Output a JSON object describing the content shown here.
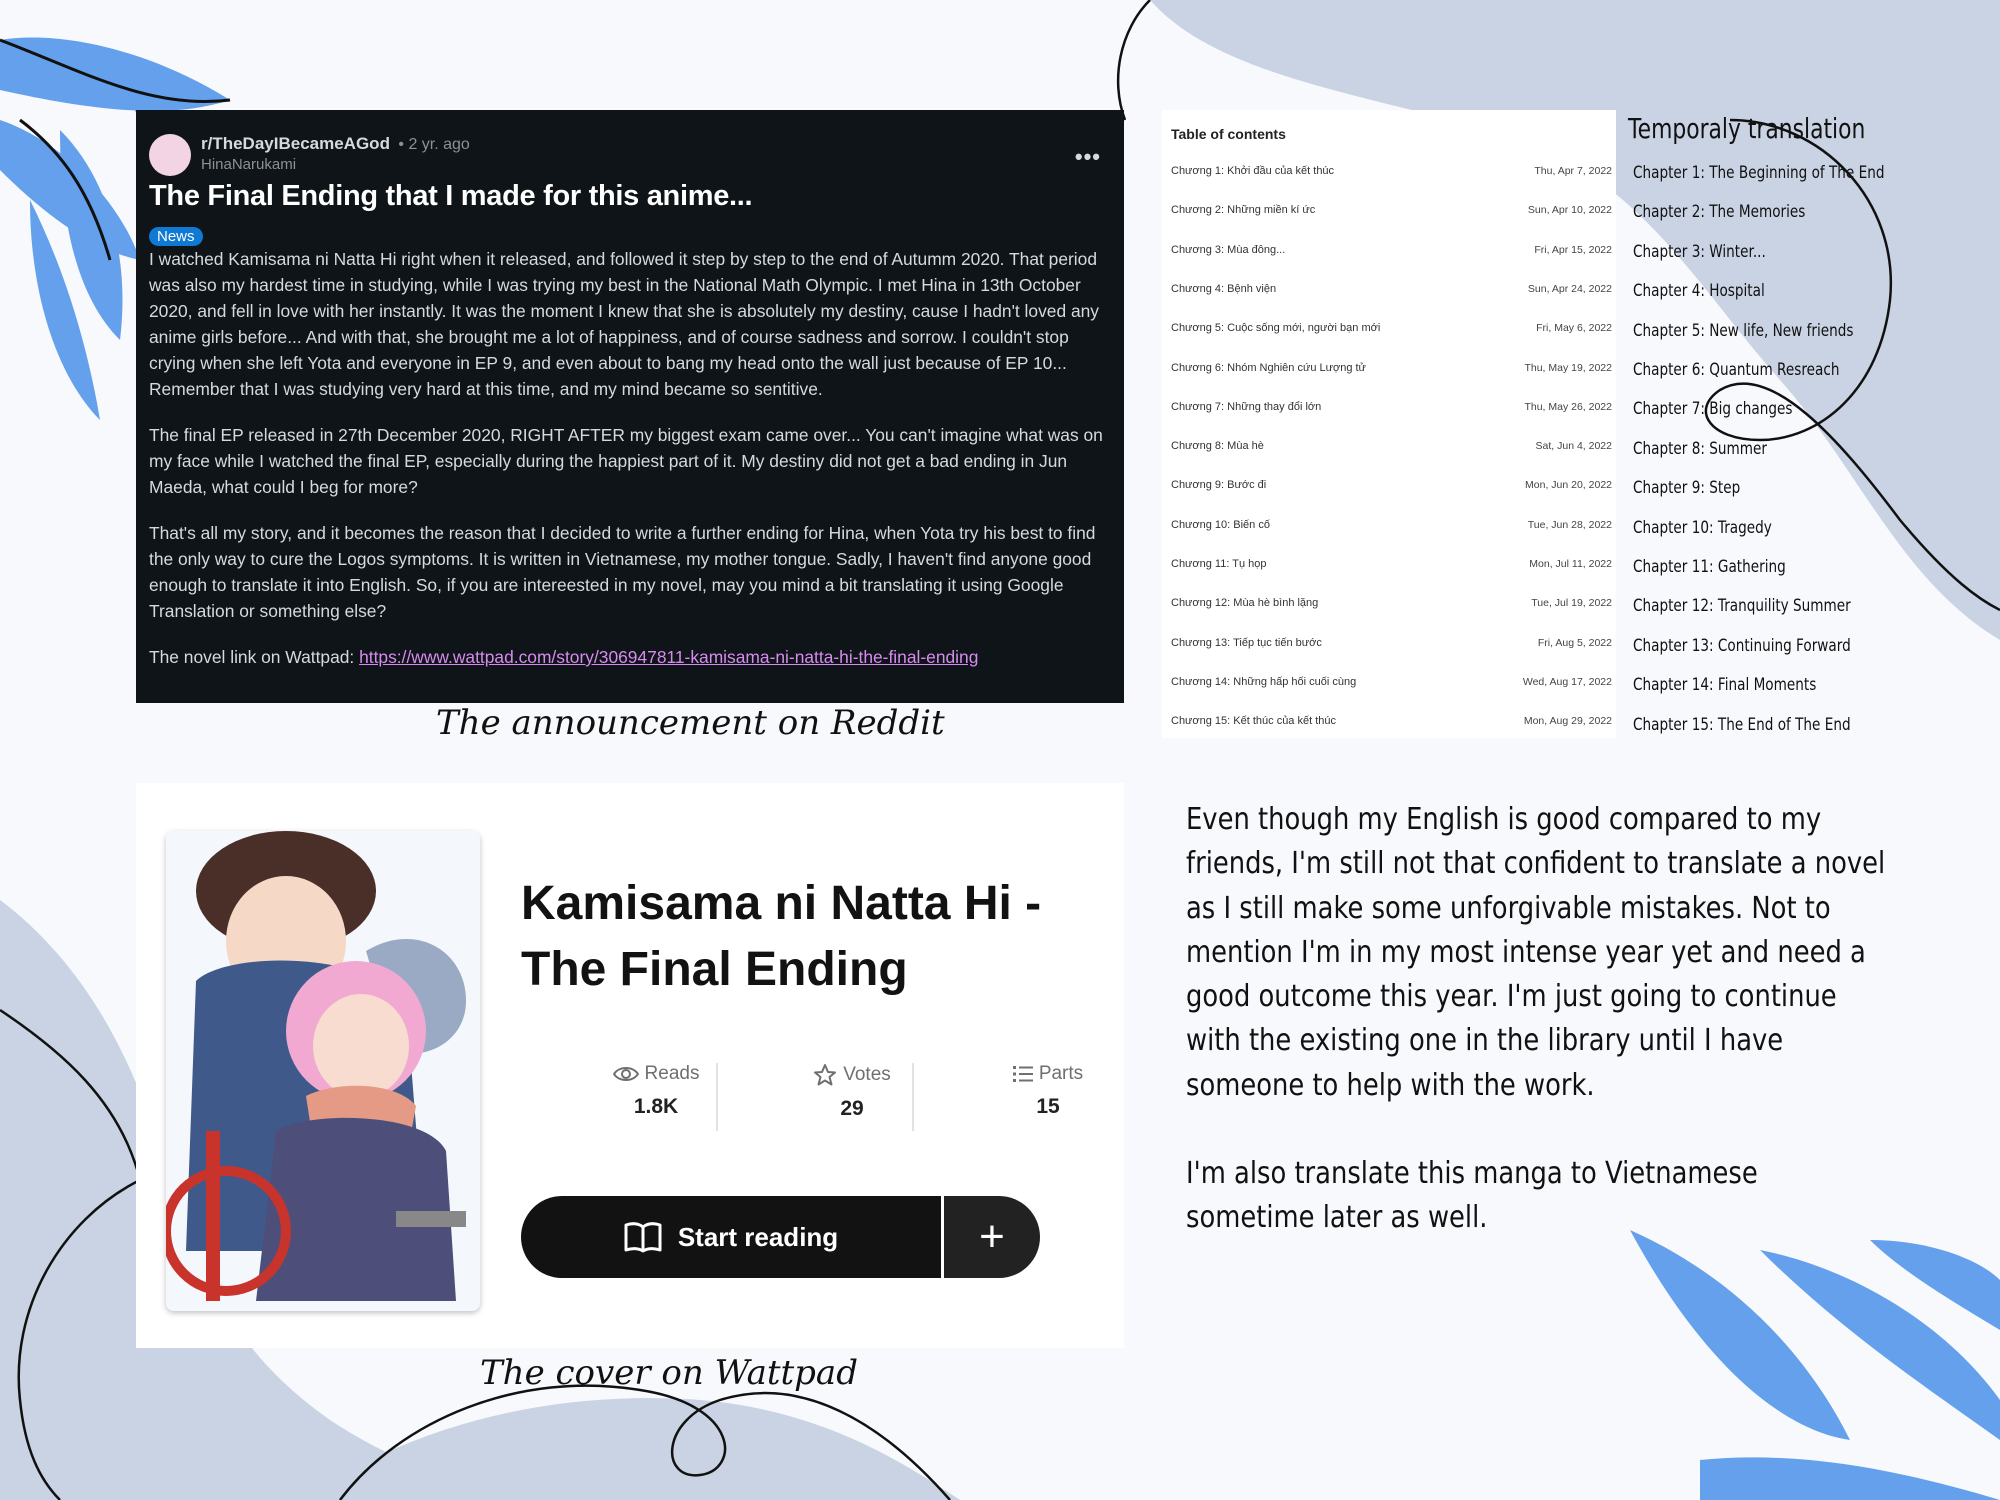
{
  "reddit": {
    "subreddit": "r/TheDayIBecameAGod",
    "time": "• 2 yr. ago",
    "user": "HinaNarukami",
    "more": "•••",
    "title": "The Final Ending that I made for this anime...",
    "badge": "News",
    "p1": "I watched Kamisama ni Natta Hi right when it released, and followed it step by step to the end of Autumm 2020. That period was also my hardest time in studying, while I was trying my best in the National Math Olympic. I met Hina in 13th October 2020, and fell in love with her instantly. It was the moment I knew that she is absolutely my destiny, cause I hadn't loved any anime girls before... And with that, she brought me a lot of happiness, and of course sadness and sorrow. I couldn't stop crying when she left Yota and everyone in EP 9, and even about to bang my head onto the wall just because of EP 10... Remember that I was studying very hard at this time, and my mind became so sentitive.",
    "p2": "The final EP released in 27th December 2020, RIGHT AFTER my biggest exam came over... You can't imagine what was on my face while I watched the final EP, especially during the happiest part of it. My destiny did not get a bad ending in Jun Maeda, what could I beg for more?",
    "p3": "That's all my story, and it becomes the reason that I decided to write a further ending for Hina, when Yota try his best to find the only way to cure the Logos symptoms. It is written in Vietnamese, my mother tongue. Sadly, I haven't find anyone good enough to translate it into English. So, if you are intereested in my novel, may you mind a bit translating it using Google Translation or something else?",
    "link_prefix": "The novel link on Wattpad: ",
    "link": "https://www.wattpad.com/story/306947811-kamisama-ni-natta-hi-the-final-ending"
  },
  "captions": {
    "reddit": "The announcement on Reddit",
    "wattpad": "The cover on Wattpad"
  },
  "toc": {
    "title": "Table of contents",
    "rows": [
      {
        "name": "Chương 1: Khởi đầu của kết thúc",
        "date": "Thu, Apr 7, 2022"
      },
      {
        "name": "Chương 2: Những miền kí ức",
        "date": "Sun, Apr 10, 2022"
      },
      {
        "name": "Chương 3: Mùa đông...",
        "date": "Fri, Apr 15, 2022"
      },
      {
        "name": "Chương 4: Bệnh viện",
        "date": "Sun, Apr 24, 2022"
      },
      {
        "name": "Chương 5: Cuộc sống mới, người bạn mới",
        "date": "Fri, May 6, 2022"
      },
      {
        "name": "Chương 6: Nhóm Nghiên cứu Lượng tử",
        "date": "Thu, May 19, 2022"
      },
      {
        "name": "Chương 7: Những thay đổi lớn",
        "date": "Thu, May 26, 2022"
      },
      {
        "name": "Chương 8: Mùa hè",
        "date": "Sat, Jun 4, 2022"
      },
      {
        "name": "Chương 9: Bước đi",
        "date": "Mon, Jun 20, 2022"
      },
      {
        "name": "Chương 10: Biến cố",
        "date": "Tue, Jun 28, 2022"
      },
      {
        "name": "Chương 11: Tụ họp",
        "date": "Mon, Jul 11, 2022"
      },
      {
        "name": "Chương 12: Mùa hè bình lặng",
        "date": "Tue, Jul 19, 2022"
      },
      {
        "name": "Chương 13: Tiếp tục tiến bước",
        "date": "Fri, Aug 5, 2022"
      },
      {
        "name": "Chương 14: Những hấp hối cuối cùng",
        "date": "Wed, Aug 17, 2022"
      },
      {
        "name": "Chương 15: Kết thúc của kết thúc",
        "date": "Mon, Aug 29, 2022"
      }
    ]
  },
  "translation": {
    "title": "Temporaly translation",
    "rows": [
      "Chapter 1: The Beginning of The End",
      "Chapter 2: The Memories",
      "Chapter 3: Winter...",
      "Chapter 4: Hospital",
      "Chapter 5: New life, New friends",
      "Chapter 6: Quantum Resreach",
      "Chapter 7: Big changes",
      "Chapter 8: Summer",
      "Chapter 9: Step",
      "Chapter 10: Tragedy",
      "Chapter 11: Gathering",
      "Chapter 12: Tranquility Summer",
      "Chapter 13: Continuing Forward",
      "Chapter 14: Final Moments",
      "Chapter 15: The End of The End"
    ]
  },
  "wattpad": {
    "title": "Kamisama ni Natta Hi - The Final Ending",
    "reads_label": "Reads",
    "reads_value": "1.8K",
    "votes_label": "Votes",
    "votes_value": "29",
    "parts_label": "Parts",
    "parts_value": "15",
    "start_label": "Start reading",
    "plus_label": "+"
  },
  "note": {
    "p1": "Even though my English is good compared to my friends, I'm still not that confident to translate a novel as I still make some unforgivable mistakes. Not to mention I'm in my most intense year yet and need a good outcome this year. I'm just going to continue with the existing one in the library until I have someone to help with the work.",
    "p2": "I'm also translate this manga to Vietnamese sometime later as well."
  },
  "colors": {
    "leaf_blue": "#4a90e8",
    "blob_gray": "#c9d3e4",
    "reddit_bg": "#0e1417",
    "reddit_link": "#d88af0",
    "news_badge": "#0f79d3"
  }
}
